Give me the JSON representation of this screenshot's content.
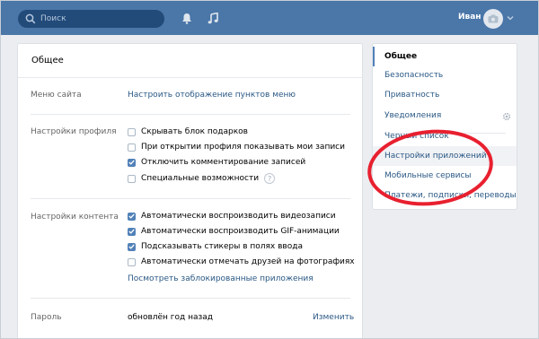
{
  "topbar": {
    "search_placeholder": "Поиск",
    "user_name": "Иван"
  },
  "main": {
    "title": "Общее",
    "menu_row": {
      "label": "Меню сайта",
      "link": "Настроить отображение пунктов меню"
    },
    "profile": {
      "label": "Настройки профиля",
      "options": [
        {
          "text": "Скрывать блок подарков",
          "checked": false
        },
        {
          "text": "При открытии профиля показывать мои записи",
          "checked": false
        },
        {
          "text": "Отключить комментирование записей",
          "checked": true
        },
        {
          "text": "Специальные возможности",
          "checked": false
        }
      ],
      "help": "?"
    },
    "content": {
      "label": "Настройки контента",
      "options": [
        {
          "text": "Автоматически воспроизводить видеозаписи",
          "checked": true
        },
        {
          "text": "Автоматически воспроизводить GIF-анимации",
          "checked": true
        },
        {
          "text": "Подсказывать стикеры в полях ввода",
          "checked": true
        },
        {
          "text": "Автоматически отмечать друзей на фотографиях",
          "checked": false
        }
      ],
      "blocked_link": "Посмотреть заблокированные приложения"
    },
    "password": {
      "label": "Пароль",
      "value": "обновлён год назад",
      "change": "Изменить"
    }
  },
  "menu": {
    "items": [
      {
        "label": "Общее",
        "active": true
      },
      {
        "label": "Безопасность"
      },
      {
        "label": "Приватность"
      },
      {
        "label": "Уведомления"
      },
      {
        "label": "Черный список"
      },
      {
        "label": "Настройки приложений",
        "hover": true
      },
      {
        "label": "Мобильные сервисы"
      },
      {
        "label": "Платежи, подписки, переводы"
      }
    ]
  },
  "colors": {
    "topbar": "#4a76a8",
    "link": "#2a5885",
    "checkbox": "#5181b8",
    "highlight": "#e8202f"
  },
  "icons": [
    "search-icon",
    "bell-icon",
    "music-icon",
    "camera-icon",
    "chevron-down-icon",
    "gear-icon",
    "check-icon"
  ]
}
